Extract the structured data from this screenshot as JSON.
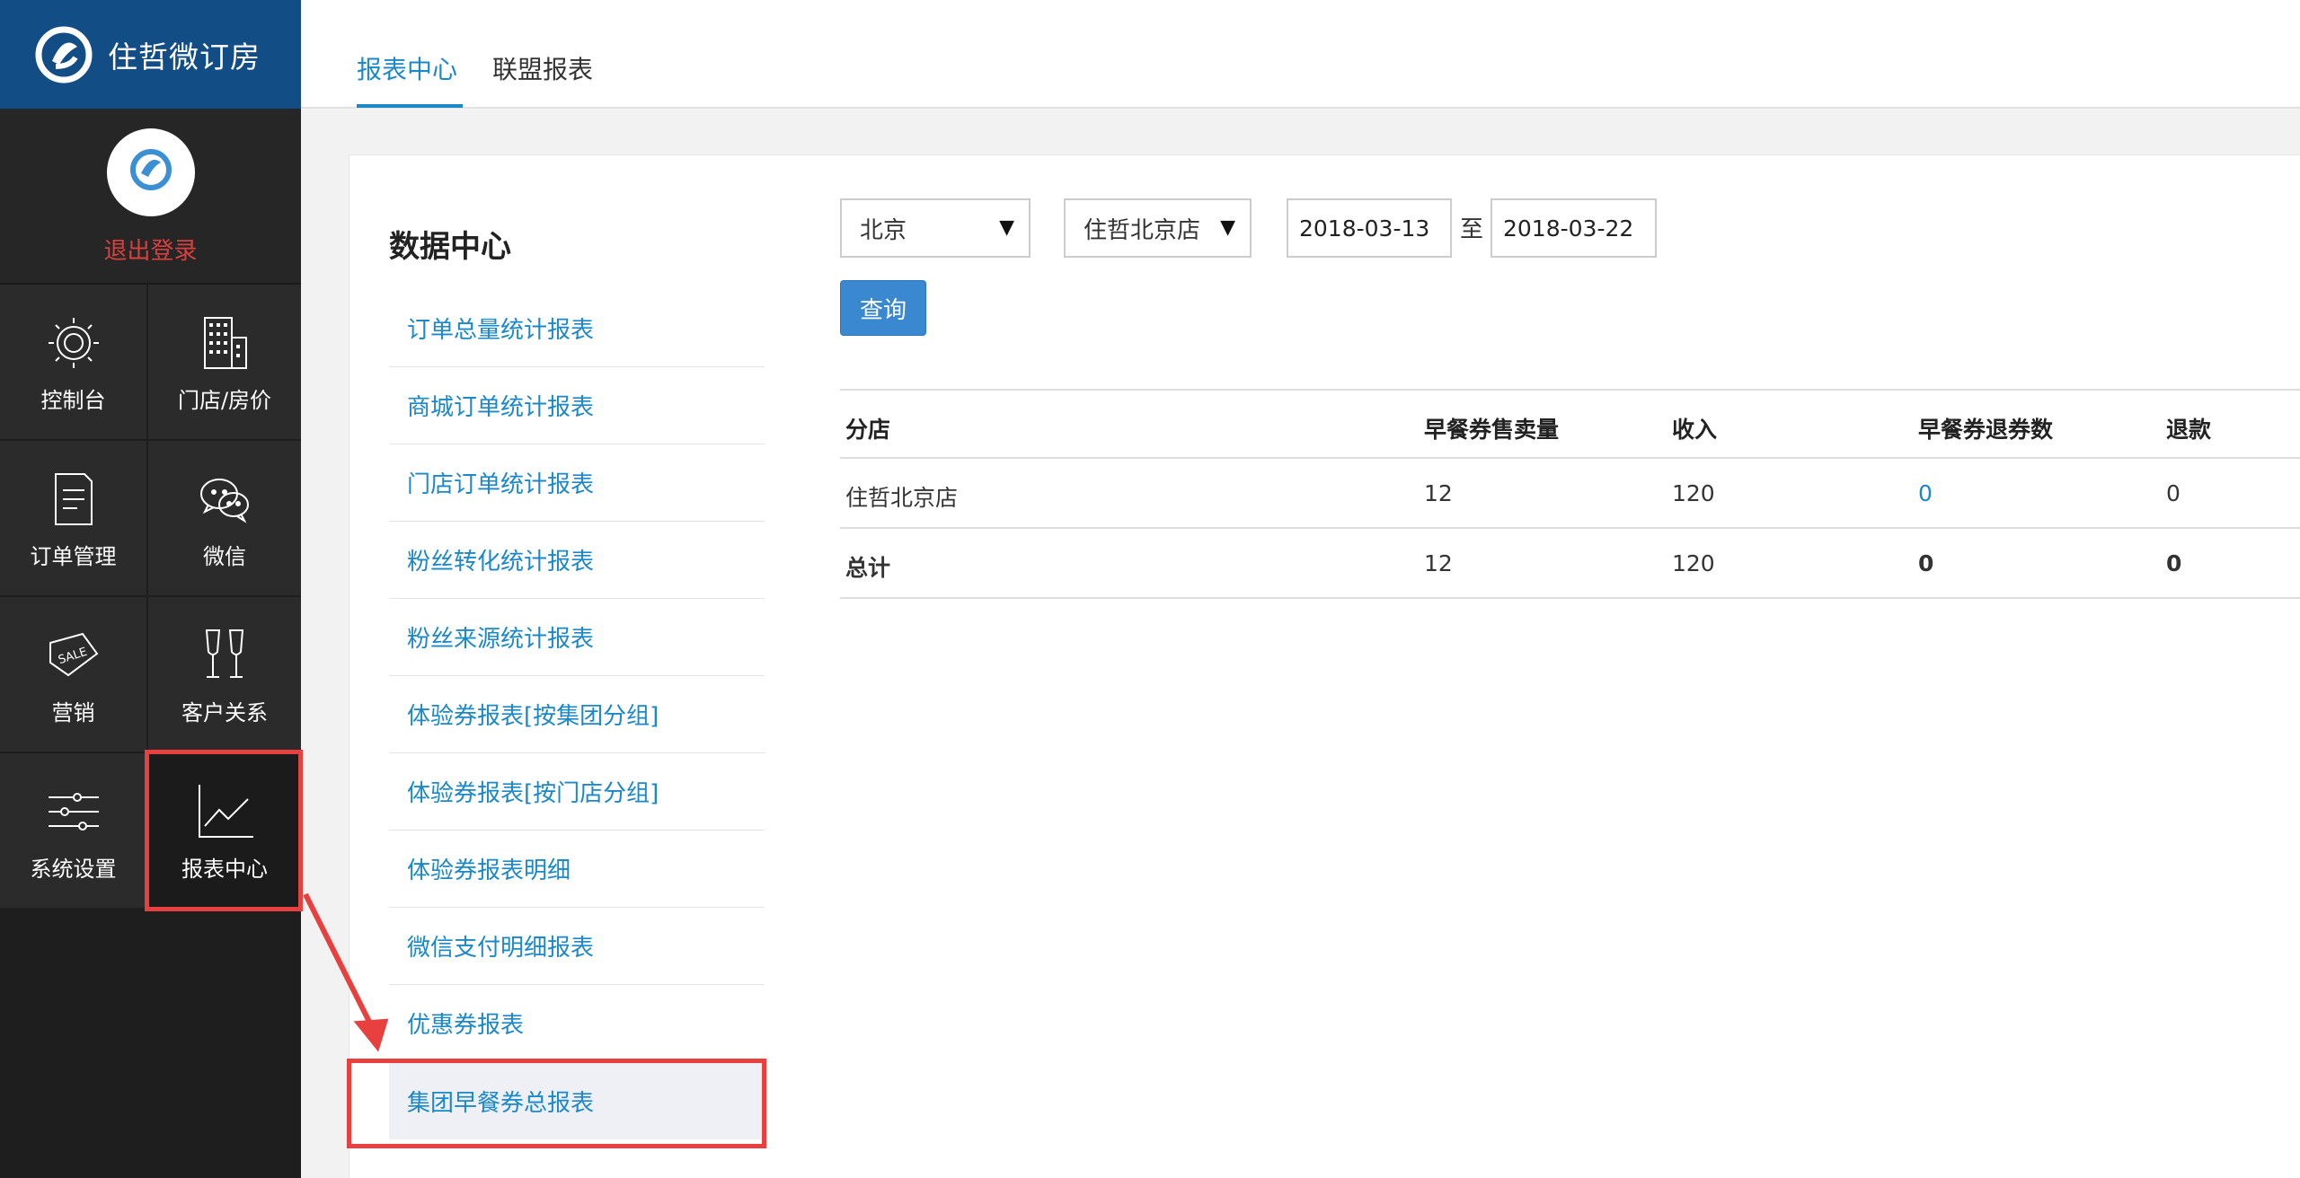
{
  "brand": {
    "name": "住哲微订房"
  },
  "user": {
    "logout_label": "退出登录"
  },
  "nav": [
    {
      "label": "控制台",
      "icon": "sun-dial-icon"
    },
    {
      "label": "门店/房价",
      "icon": "building-icon"
    },
    {
      "label": "订单管理",
      "icon": "document-icon"
    },
    {
      "label": "微信",
      "icon": "wechat-icon"
    },
    {
      "label": "营销",
      "icon": "sale-tag-icon"
    },
    {
      "label": "客户关系",
      "icon": "glasses-icon"
    },
    {
      "label": "系统设置",
      "icon": "sliders-icon"
    },
    {
      "label": "报表中心",
      "icon": "line-chart-icon"
    }
  ],
  "topbar": {
    "tabs": [
      "报表中心",
      "联盟报表"
    ]
  },
  "left_panel": {
    "title": "数据中心",
    "reports": [
      "订单总量统计报表",
      "商城订单统计报表",
      "门店订单统计报表",
      "粉丝转化统计报表",
      "粉丝来源统计报表",
      "体验券报表[按集团分组]",
      "体验券报表[按门店分组]",
      "体验券报表明细",
      "微信支付明细报表",
      "优惠券报表",
      "集团早餐券总报表"
    ]
  },
  "filters": {
    "city": "北京",
    "store": "住哲北京店",
    "date_from": "2018-03-13",
    "date_sep": "至",
    "date_to": "2018-03-22",
    "query_label": "查询"
  },
  "table": {
    "headers": [
      "分店",
      "早餐券售卖量",
      "收入",
      "早餐券退券数",
      "退款"
    ],
    "rows": [
      [
        "住哲北京店",
        "12",
        "120",
        "0",
        "0"
      ]
    ],
    "total": [
      "总计",
      "12",
      "120",
      "0",
      "0"
    ]
  }
}
